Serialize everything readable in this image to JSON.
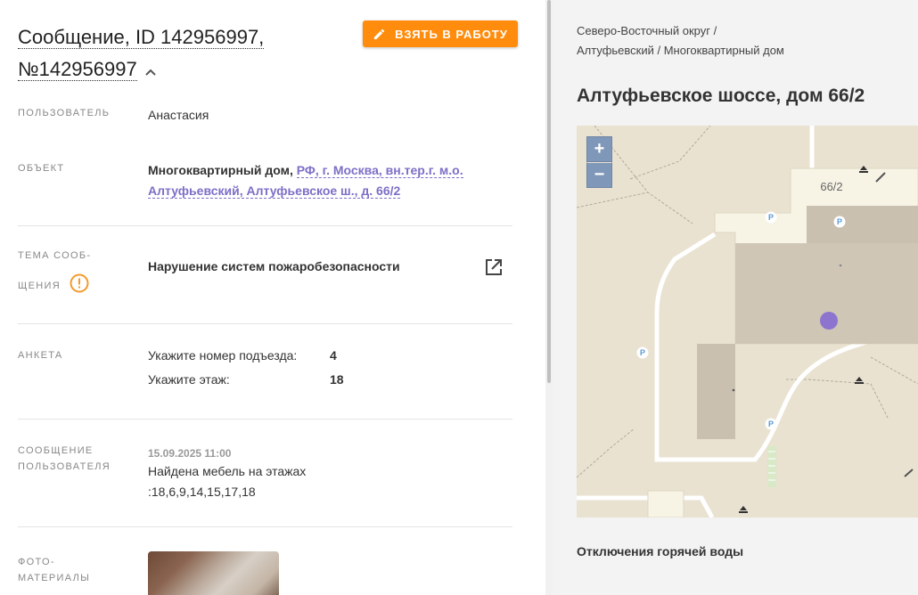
{
  "message": {
    "title": "Сообщение, ID 142956997, №142956997",
    "take_button": "ВЗЯТЬ В РАБОТУ",
    "user_label": "ПОЛЬЗОВАТЕЛЬ",
    "user_value": "Анастасия",
    "object_label": "ОБЪЕКТ",
    "object_type": "Многоквартирный дом,",
    "object_address": "РФ, г. Москва, вн.тер.г. м.о. Алтуфьевский, Алтуфьевское ш., д. 66/2",
    "topic_label_1": "ТЕМА СООБ-",
    "topic_label_2": "ЩЕНИЯ",
    "topic_value": "Нарушение систем пожаробезопасности",
    "survey_label": "АНКЕТА",
    "survey": [
      {
        "question": "Укажите номер подъезда:",
        "answer": "4"
      },
      {
        "question": "Укажите этаж:",
        "answer": "18"
      }
    ],
    "user_message_label_1": "СООБЩЕНИЕ",
    "user_message_label_2": "ПОЛЬЗОВАТЕЛЯ",
    "user_message_date": "15.09.2025 11:00",
    "user_message_text_1": "Найдена мебель на этажах",
    "user_message_text_2": ":18,6,9,14,15,17,18",
    "photos_label_1": "ФОТО-",
    "photos_label_2": "МАТЕРИАЛЫ"
  },
  "side": {
    "breadcrumb_1": "Северо-Восточный округ /",
    "breadcrumb_2": "Алтуфьевский / Многоквартирный дом",
    "address_title": "Алтуфьевское шоссе, дом 66/2",
    "map_house_label": "66/2",
    "zoom_in": "+",
    "zoom_out": "−",
    "outage_title": "Отключения горячей воды"
  },
  "colors": {
    "accent_orange": "#ff8c0c",
    "link_purple": "#7d6fc7",
    "warning_orange": "#f39a2b",
    "map_marker": "#8d75cf"
  }
}
